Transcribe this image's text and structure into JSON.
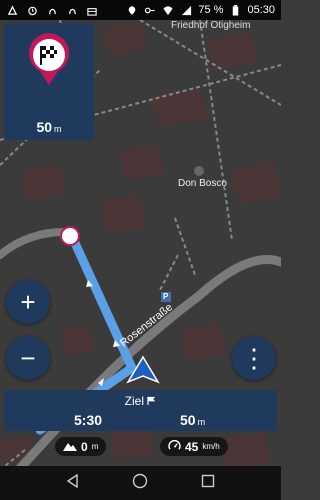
{
  "status_bar": {
    "battery_percent": "75 %",
    "time": "05:30"
  },
  "map": {
    "cemetery_label": "Friedhof Otigheim",
    "poi_label": "Don Bosco",
    "street_label": "Rosenstraße",
    "parking_label": "P"
  },
  "next_turn": {
    "distance_value": "50",
    "distance_unit": "m",
    "icon": "destination-flag-icon"
  },
  "controls": {
    "zoom_in": "+",
    "zoom_out": "−",
    "more": "⋮"
  },
  "nav_info": {
    "destination_label": "Ziel",
    "arrival_time": "5:30",
    "remaining_value": "50",
    "remaining_unit": "m"
  },
  "chips": {
    "elevation_value": "0",
    "elevation_unit": "m",
    "speed_value": "45",
    "speed_unit": "km/h"
  },
  "colors": {
    "panel": "#1f3a5c",
    "route": "#5aa0e6",
    "pin": "#c2185b"
  }
}
